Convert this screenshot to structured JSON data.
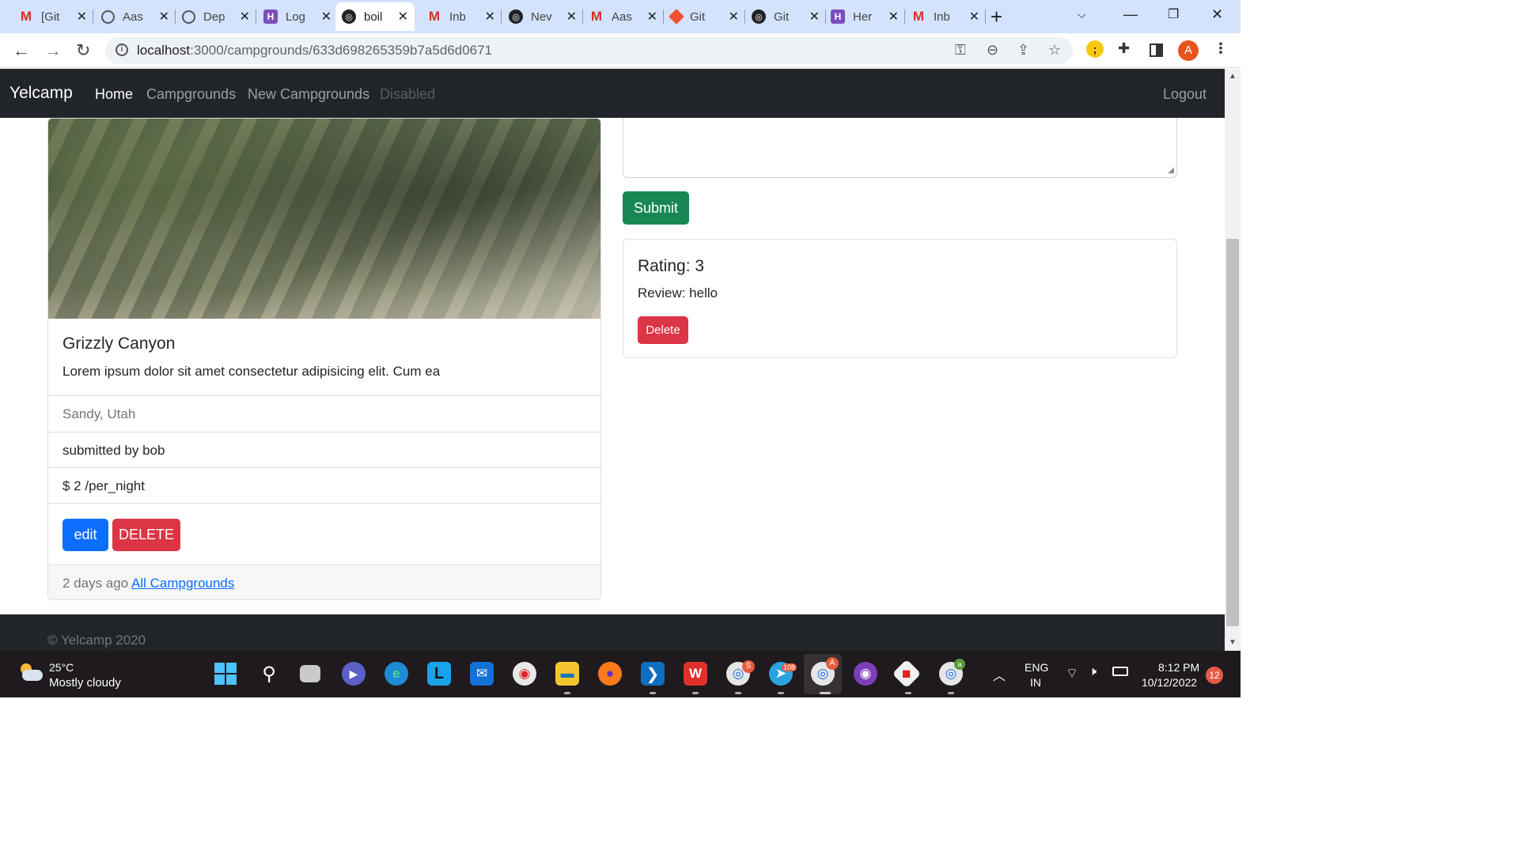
{
  "browser": {
    "tabs": [
      {
        "icon": "gmail-icon",
        "title": "[Git"
      },
      {
        "icon": "github-icon",
        "title": "Aas"
      },
      {
        "icon": "github-icon",
        "title": "Dep"
      },
      {
        "icon": "heroku-icon",
        "title": "Log"
      },
      {
        "icon": "globe-icon",
        "title": "boil",
        "active": true
      },
      {
        "icon": "gmail-icon",
        "title": "Inb"
      },
      {
        "icon": "chromium-icon",
        "title": "Nev"
      },
      {
        "icon": "gmail-icon",
        "title": "Aas"
      },
      {
        "icon": "git-icon",
        "title": "Git"
      },
      {
        "icon": "globe-icon",
        "title": "Git"
      },
      {
        "icon": "heroku-icon",
        "title": "Her"
      },
      {
        "icon": "gmail-icon",
        "title": "Inb"
      }
    ],
    "url_host": "localhost",
    "url_path": ":3000/campgrounds/633d698265359b7a5d6d0671",
    "profile_initial": "A"
  },
  "navbar": {
    "brand": "Yelcamp",
    "links": [
      "Home",
      "Campgrounds",
      "New Campgrounds",
      "Disabled"
    ],
    "logout": "Logout"
  },
  "campground": {
    "title": "Grizzly Canyon",
    "description": "Lorem ipsum dolor sit amet consectetur adipisicing elit. Cum ea",
    "location": "Sandy, Utah",
    "submitted_by": "submitted by bob",
    "price": "$ 2 /per_night",
    "edit_label": "edit",
    "delete_label": "DELETE",
    "posted": "2 days ago",
    "all_link": "All Campgrounds"
  },
  "review_form": {
    "submit_label": "Submit"
  },
  "reviews": [
    {
      "rating": "Rating: 3",
      "text": "Review: hello",
      "delete_label": "Delete"
    }
  ],
  "footer": {
    "copyright": "© Yelcamp 2020"
  },
  "taskbar": {
    "temperature": "25°C",
    "condition": "Mostly cloudy",
    "language": "ENG",
    "region": "IN",
    "time": "8:12 PM",
    "date": "10/12/2022",
    "notifications": "12",
    "badges": {
      "chrome_s": "S",
      "telegram": "108",
      "chrome_a": "A",
      "chrome_a2": "a"
    }
  }
}
